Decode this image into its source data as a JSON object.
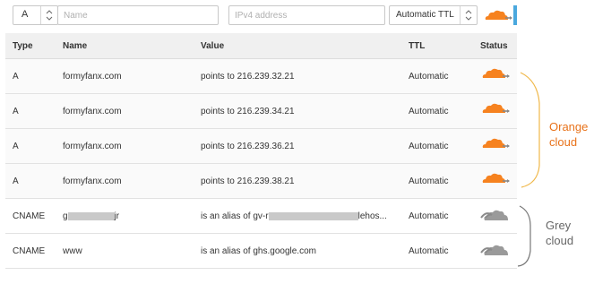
{
  "colors": {
    "orange": "#f6821f",
    "grey": "#8a8a8a",
    "annotation_orange": "#e8721a",
    "annotation_grey": "#666666"
  },
  "add_record": {
    "type_value": "A",
    "name_placeholder": "Name",
    "value_placeholder": "IPv4 address",
    "ttl_value": "Automatic TTL",
    "status_icon": "orange-cloud-icon"
  },
  "table": {
    "headers": {
      "type": "Type",
      "name": "Name",
      "value": "Value",
      "ttl": "TTL",
      "status": "Status"
    },
    "rows": [
      {
        "type": "A",
        "name": "formyfanx.com",
        "value": "points to 216.239.32.21",
        "ttl": "Automatic",
        "status": "orange-cloud-icon"
      },
      {
        "type": "A",
        "name": "formyfanx.com",
        "value": "points to 216.239.34.21",
        "ttl": "Automatic",
        "status": "orange-cloud-icon"
      },
      {
        "type": "A",
        "name": "formyfanx.com",
        "value": "points to 216.239.36.21",
        "ttl": "Automatic",
        "status": "orange-cloud-icon"
      },
      {
        "type": "A",
        "name": "formyfanx.com",
        "value": "points to 216.239.38.21",
        "ttl": "Automatic",
        "status": "orange-cloud-icon"
      },
      {
        "type": "CNAME",
        "name_prefix": "g",
        "name_suffix": "jr",
        "value_prefix": "is an alias of gv-r",
        "value_suffix": "lehos...",
        "ttl": "Automatic",
        "status": "grey-cloud-icon"
      },
      {
        "type": "CNAME",
        "name": "www",
        "value": "is an alias of ghs.google.com",
        "ttl": "Automatic",
        "status": "grey-cloud-icon"
      }
    ]
  },
  "annotations": {
    "orange": {
      "line1": "Orange",
      "line2": "cloud"
    },
    "grey": {
      "line1": "Grey",
      "line2": "cloud"
    }
  }
}
